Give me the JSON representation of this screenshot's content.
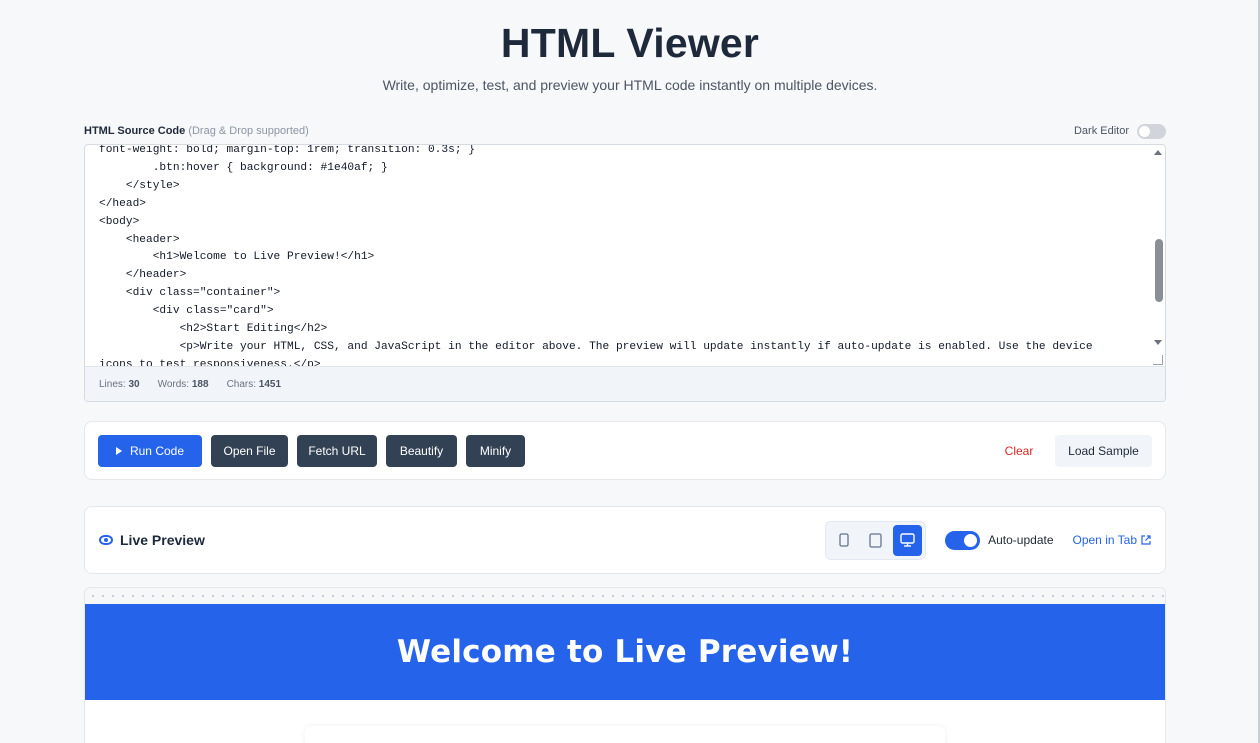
{
  "header": {
    "title": "HTML Viewer",
    "subtitle": "Write, optimize, test, and preview your HTML code instantly on multiple devices."
  },
  "editor": {
    "label": "HTML Source Code",
    "label_hint": "(Drag & Drop supported)",
    "dark_editor_label": "Dark Editor",
    "dark_editor_on": false,
    "code_lines": [
      "font-weight: bold; margin-top: 1rem; transition: 0.3s; }",
      "        .btn:hover { background: #1e40af; }",
      "    </style>",
      "</head>",
      "<body>",
      "    <header>",
      "        <h1>Welcome to Live Preview!</h1>",
      "    </header>",
      "    <div class=\"container\">",
      "        <div class=\"card\">",
      "            <h2>Start Editing</h2>",
      "            <p>Write your HTML, CSS, and JavaScript in the editor above. The preview will update instantly if auto-update is enabled. Use the device",
      "icons to test responsiveness.</p>"
    ],
    "stats": {
      "lines_label": "Lines:",
      "lines": "30",
      "words_label": "Words:",
      "words": "188",
      "chars_label": "Chars:",
      "chars": "1451"
    }
  },
  "toolbar": {
    "run": "Run Code",
    "open_file": "Open File",
    "fetch_url": "Fetch URL",
    "beautify": "Beautify",
    "minify": "Minify",
    "clear": "Clear",
    "load_sample": "Load Sample"
  },
  "preview": {
    "title": "Live Preview",
    "devices": [
      "mobile",
      "tablet",
      "desktop"
    ],
    "active_device": "desktop",
    "auto_update_label": "Auto-update",
    "auto_update_on": true,
    "open_tab": "Open in Tab",
    "banner_text": "Welcome to Live Preview!"
  },
  "colors": {
    "accent": "#2563eb",
    "dark_button": "#334155",
    "danger": "#dc2626"
  }
}
